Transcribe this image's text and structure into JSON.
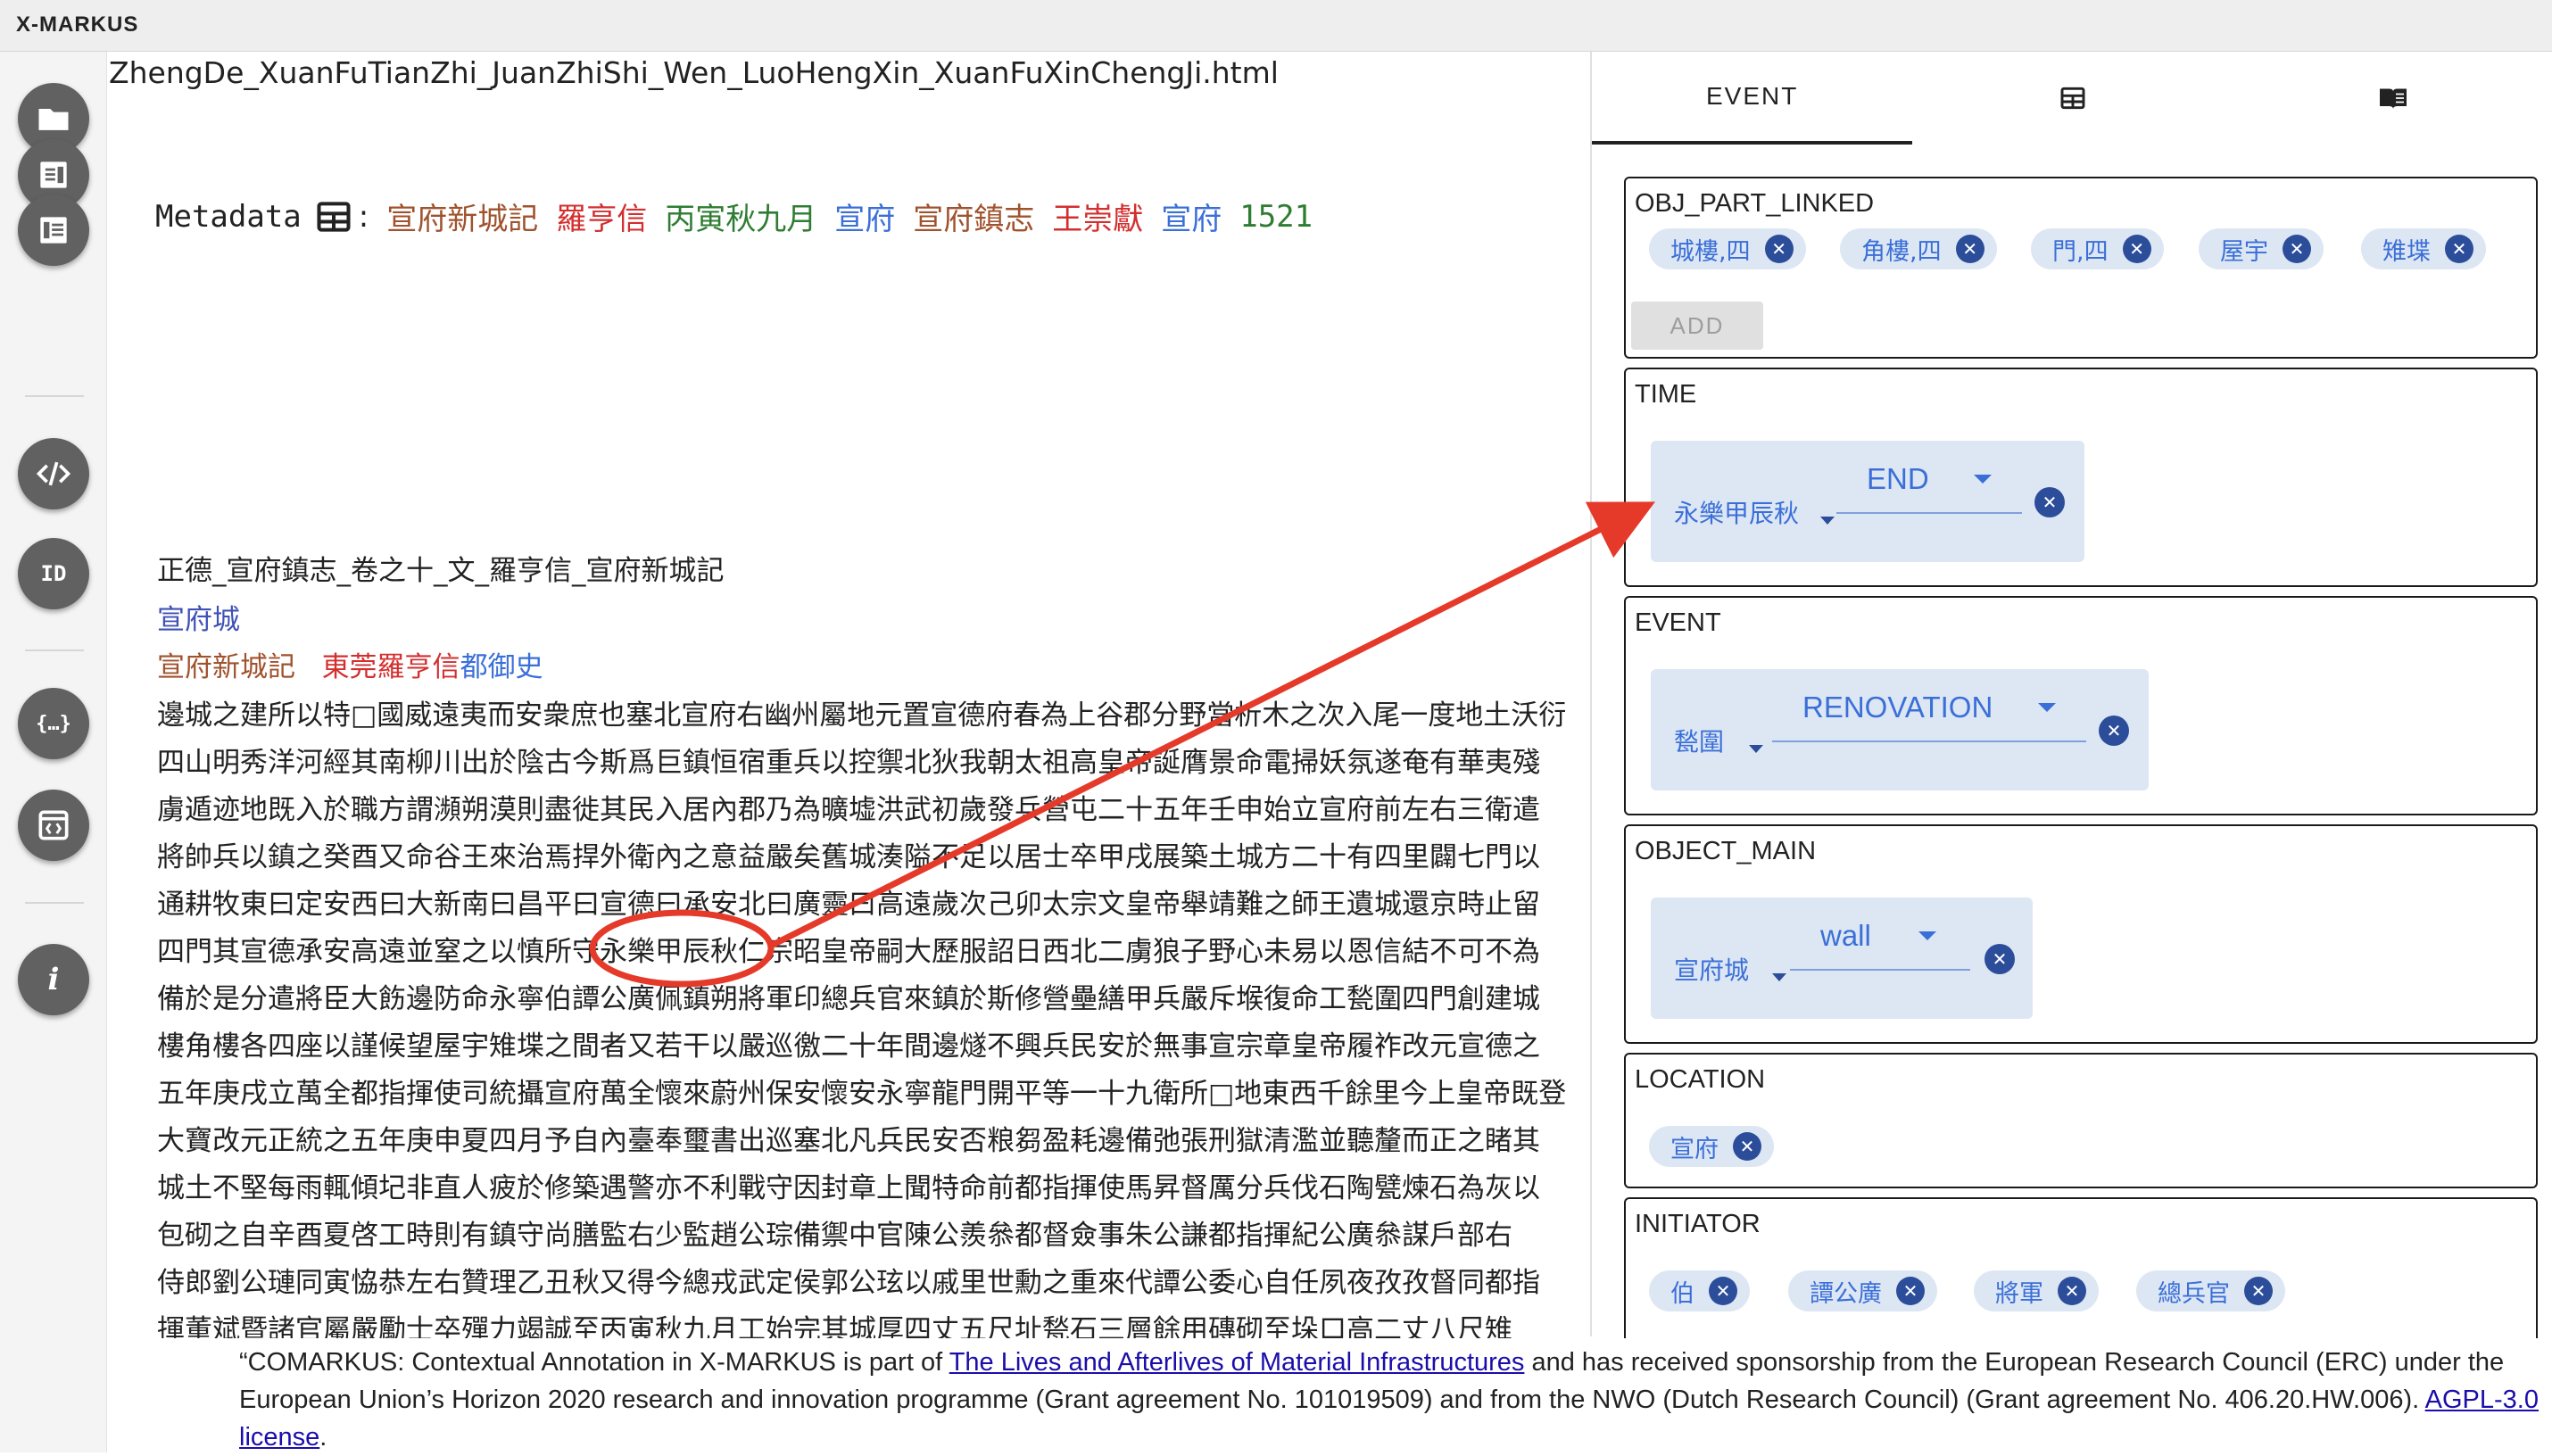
{
  "app": {
    "title": "X-MARKUS"
  },
  "toolbar": {
    "items": [
      {
        "name": "open-folder-icon"
      },
      {
        "name": "document-view-icon"
      },
      {
        "name": "reader-view-icon"
      },
      {
        "name": "code-view-icon",
        "glyph": "</>"
      },
      {
        "name": "id-icon",
        "glyph": "ID"
      },
      {
        "name": "json-braces-icon",
        "glyph": "{...}"
      },
      {
        "name": "export-icon"
      },
      {
        "name": "info-icon",
        "glyph": "i"
      }
    ]
  },
  "document": {
    "filename": "ZhengDe_XuanFuTianZhi_JuanZhiShi_Wen_LuoHengXin_XuanFuXinChengJi.html",
    "metadata_label": "Metadata",
    "metadata_colon": ":",
    "metadata_values": [
      "宣府新城記",
      "羅亨信",
      "丙寅秋九月",
      "宣府",
      "宣府鎮志",
      "王崇獻",
      "宣府",
      "1521"
    ],
    "title": "正德_宣府鎮志_卷之十_文_羅亨信_宣府新城記",
    "line1": "宣府城",
    "line2": [
      "宣府新城記",
      "東莞羅亨信",
      "都御史"
    ],
    "paragraph_lines": [
      "邊城之建所以特□國威遠夷而安衆庶也塞北宣府右幽州屬地元置宣德府春為上谷郡分野當析木之次入尾一度地土沃衍",
      "四山明秀洋河經其南柳川出於陰古今斯爲巨鎮恒宿重兵以控禦北狄我朝太祖高皇帝誕膺景命電掃妖氛遂奄有華夷殘",
      "虜遁迹地既入於職方謂瀕朔漠則盡徙其民入居內郡乃為曠墟洪武初歲發兵營屯二十五年壬申始立宣府前左右三衛遣",
      "將帥兵以鎮之癸酉又命谷王來治焉捍外衛內之意益嚴矣舊城湊隘不足以居士卒甲戌展築土城方二十有四里闢七門以",
      "通耕牧東曰定安西曰大新南曰昌平曰宣德曰承安北曰廣靈曰高遠歲次己卯太宗文皇帝舉靖難之師王遺城還京時止留",
      "四門其宣德承安高遠並窒之以慎所守永樂甲辰秋仁宗昭皇帝嗣大歷服詔日西北二虜狼子野心未易以恩信結不可不為",
      "備於是分遣將臣大飭邊防命永寧伯譚公廣佩鎮朔將軍印總兵官來鎮於斯修營壘繕甲兵嚴斥堠復命工甃圍四門創建城",
      "樓角樓各四座以謹候望屋宇雉堞之間者又若干以嚴巡徼二十年間邊燧不興兵民安於無事宣宗章皇帝履祚改元宣德之",
      "五年庚戌立萬全都指揮使司統攝宣府萬全懷來蔚州保安懷安永寧龍門開平等一十九衛所□地東西千餘里今上皇帝既登",
      "大寶改元正統之五年庚申夏四月予自內臺奉璽書出巡塞北凡兵民安否粮芻盈耗邊備弛張刑獄清濫並聽釐而正之睹其",
      "城土不堅每雨輒傾圮非直人疲於修築遇警亦不利戰守因封章上聞特命前都指揮使馬昇督厲分兵伐石陶甓煉石為灰以",
      "包砌之自辛酉夏啓工時則有鎮守尚膳監右少監趙公琮備禦中官陳公羨叅都督僉事朱公謙都指揮紀公廣叅謀戶部右",
      "侍郎劉公璉同寅恊恭左右贊理乙丑秋又得今總戎武定侯郭公玹以戚里世勳之重來代譚公委心自任夙夜孜孜督同都指",
      "揮董斌暨諸官屬嚴勵士卒殫力竭誠至丙寅秋九月工始完其城厚四丈五尺址甃石三層餘用磚砌至垛口高二丈八尺雉"
    ]
  },
  "panel": {
    "tabs": [
      {
        "label": "EVENT",
        "active": true
      },
      {
        "label": "",
        "icon": "table-icon"
      },
      {
        "label": "",
        "icon": "book-icon"
      }
    ],
    "cards": {
      "obj_part_linked": {
        "label": "OBJ_PART_LINKED",
        "chips": [
          "城樓,四",
          "角樓,四",
          "門,四",
          "屋宇",
          "雉堞"
        ],
        "add_label": "ADD"
      },
      "time": {
        "label": "TIME",
        "value": "永樂甲辰秋",
        "option": "END"
      },
      "event": {
        "label": "EVENT",
        "value": "甃圍",
        "option": "RENOVATION"
      },
      "object_main": {
        "label": "OBJECT_MAIN",
        "value": "宣府城",
        "option": "wall"
      },
      "location": {
        "label": "LOCATION",
        "chips": [
          "宣府"
        ]
      },
      "initiator": {
        "label": "INITIATOR",
        "chips": [
          "伯",
          "譚公廣",
          "將軍",
          "總兵官"
        ]
      }
    },
    "remove_glyph": "✕"
  },
  "footer": {
    "text_before": "“COMARKUS: Contextual Annotation in X-MARKUS is part of ",
    "link1": "The Lives and Afterlives of Material Infrastructures",
    "text_middle": " and has received sponsorship from the European Research Council (ERC) under the European Union’s Horizon 2020 research and innovation programme (Grant agreement No. 101019509) and from the NWO (Dutch Research Council) (Grant agreement No. 406.20.HW.006). ",
    "link2": "AGPL-3.0 license",
    "text_after": "."
  },
  "colors": {
    "accent": "#3b6fd8",
    "chip_bg": "#dde7f4",
    "annotation": "#e53a2a",
    "toolbar_button": "#616161"
  }
}
